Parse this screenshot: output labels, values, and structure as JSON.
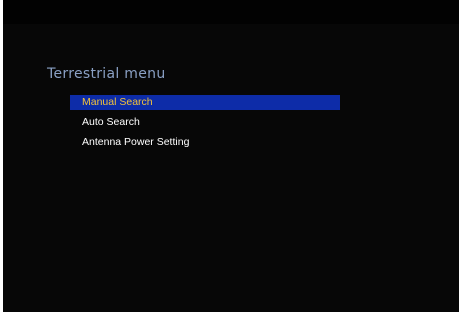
{
  "menu": {
    "title": "Terrestrial menu",
    "items": [
      {
        "label": "Manual Search"
      },
      {
        "label": "Auto Search"
      },
      {
        "label": "Antenna Power Setting"
      }
    ],
    "selected_item": "Manual Search"
  },
  "colors": {
    "background": "#070707",
    "title": "#8aa0c4",
    "highlight": "#0d2ca8",
    "highlight_text": "#f2c33a",
    "item_text": "#ffffff"
  }
}
